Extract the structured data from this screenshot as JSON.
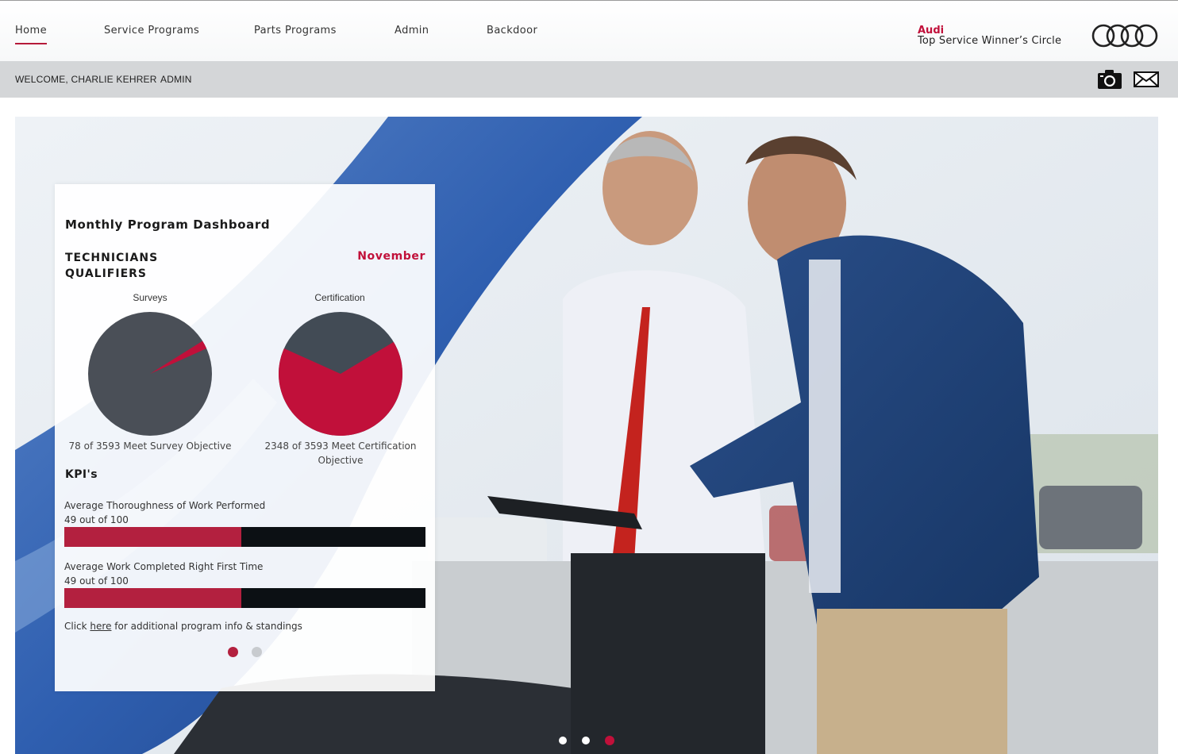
{
  "nav": {
    "items": [
      {
        "label": "Home",
        "active": true
      },
      {
        "label": "Service Programs"
      },
      {
        "label": "Parts Programs"
      },
      {
        "label": "Admin"
      },
      {
        "label": "Backdoor"
      }
    ]
  },
  "brand": {
    "name": "Audi",
    "subtitle": "Top Service Winner’s Circle",
    "logo_icon": "audi-rings-icon",
    "accent_color": "#c1103a"
  },
  "welcome": {
    "greeting": "WELCOME, CHARLIE KEHRER",
    "admin_label": "ADMIN",
    "icons": [
      "camera-icon",
      "mail-icon"
    ]
  },
  "dashboard": {
    "title": "Monthly Program Dashboard",
    "section_line1": "TECHNICIANS",
    "section_line2": "QUALIFIERS",
    "month": "November",
    "pies": [
      {
        "label": "Surveys",
        "met": 78,
        "total": 3593,
        "caption": "78 of 3593 Meet Survey Objective",
        "met_color": "#c1103a",
        "rest_color": "#4a4f57"
      },
      {
        "label": "Certification",
        "met": 2348,
        "total": 3593,
        "caption_line1": "2348 of 3593 Meet Certification",
        "caption_line2": "Objective",
        "met_color": "#c1103a",
        "rest_color": "#424b55"
      }
    ],
    "kpi_title": "KPI's",
    "kpis": [
      {
        "name": "Average Thoroughness of Work Performed",
        "value_text": "49 out of 100",
        "value": 49,
        "max": 100
      },
      {
        "name": "Average Work Completed Right First Time",
        "value_text": "49 out of 100",
        "value": 49,
        "max": 100
      }
    ],
    "footer_prefix": "Click ",
    "footer_link": "here",
    "footer_suffix": " for additional program info & standings",
    "carousel_dots": 2,
    "carousel_active": 0
  },
  "hero": {
    "carousel_dots": 3,
    "carousel_active": 2
  }
}
